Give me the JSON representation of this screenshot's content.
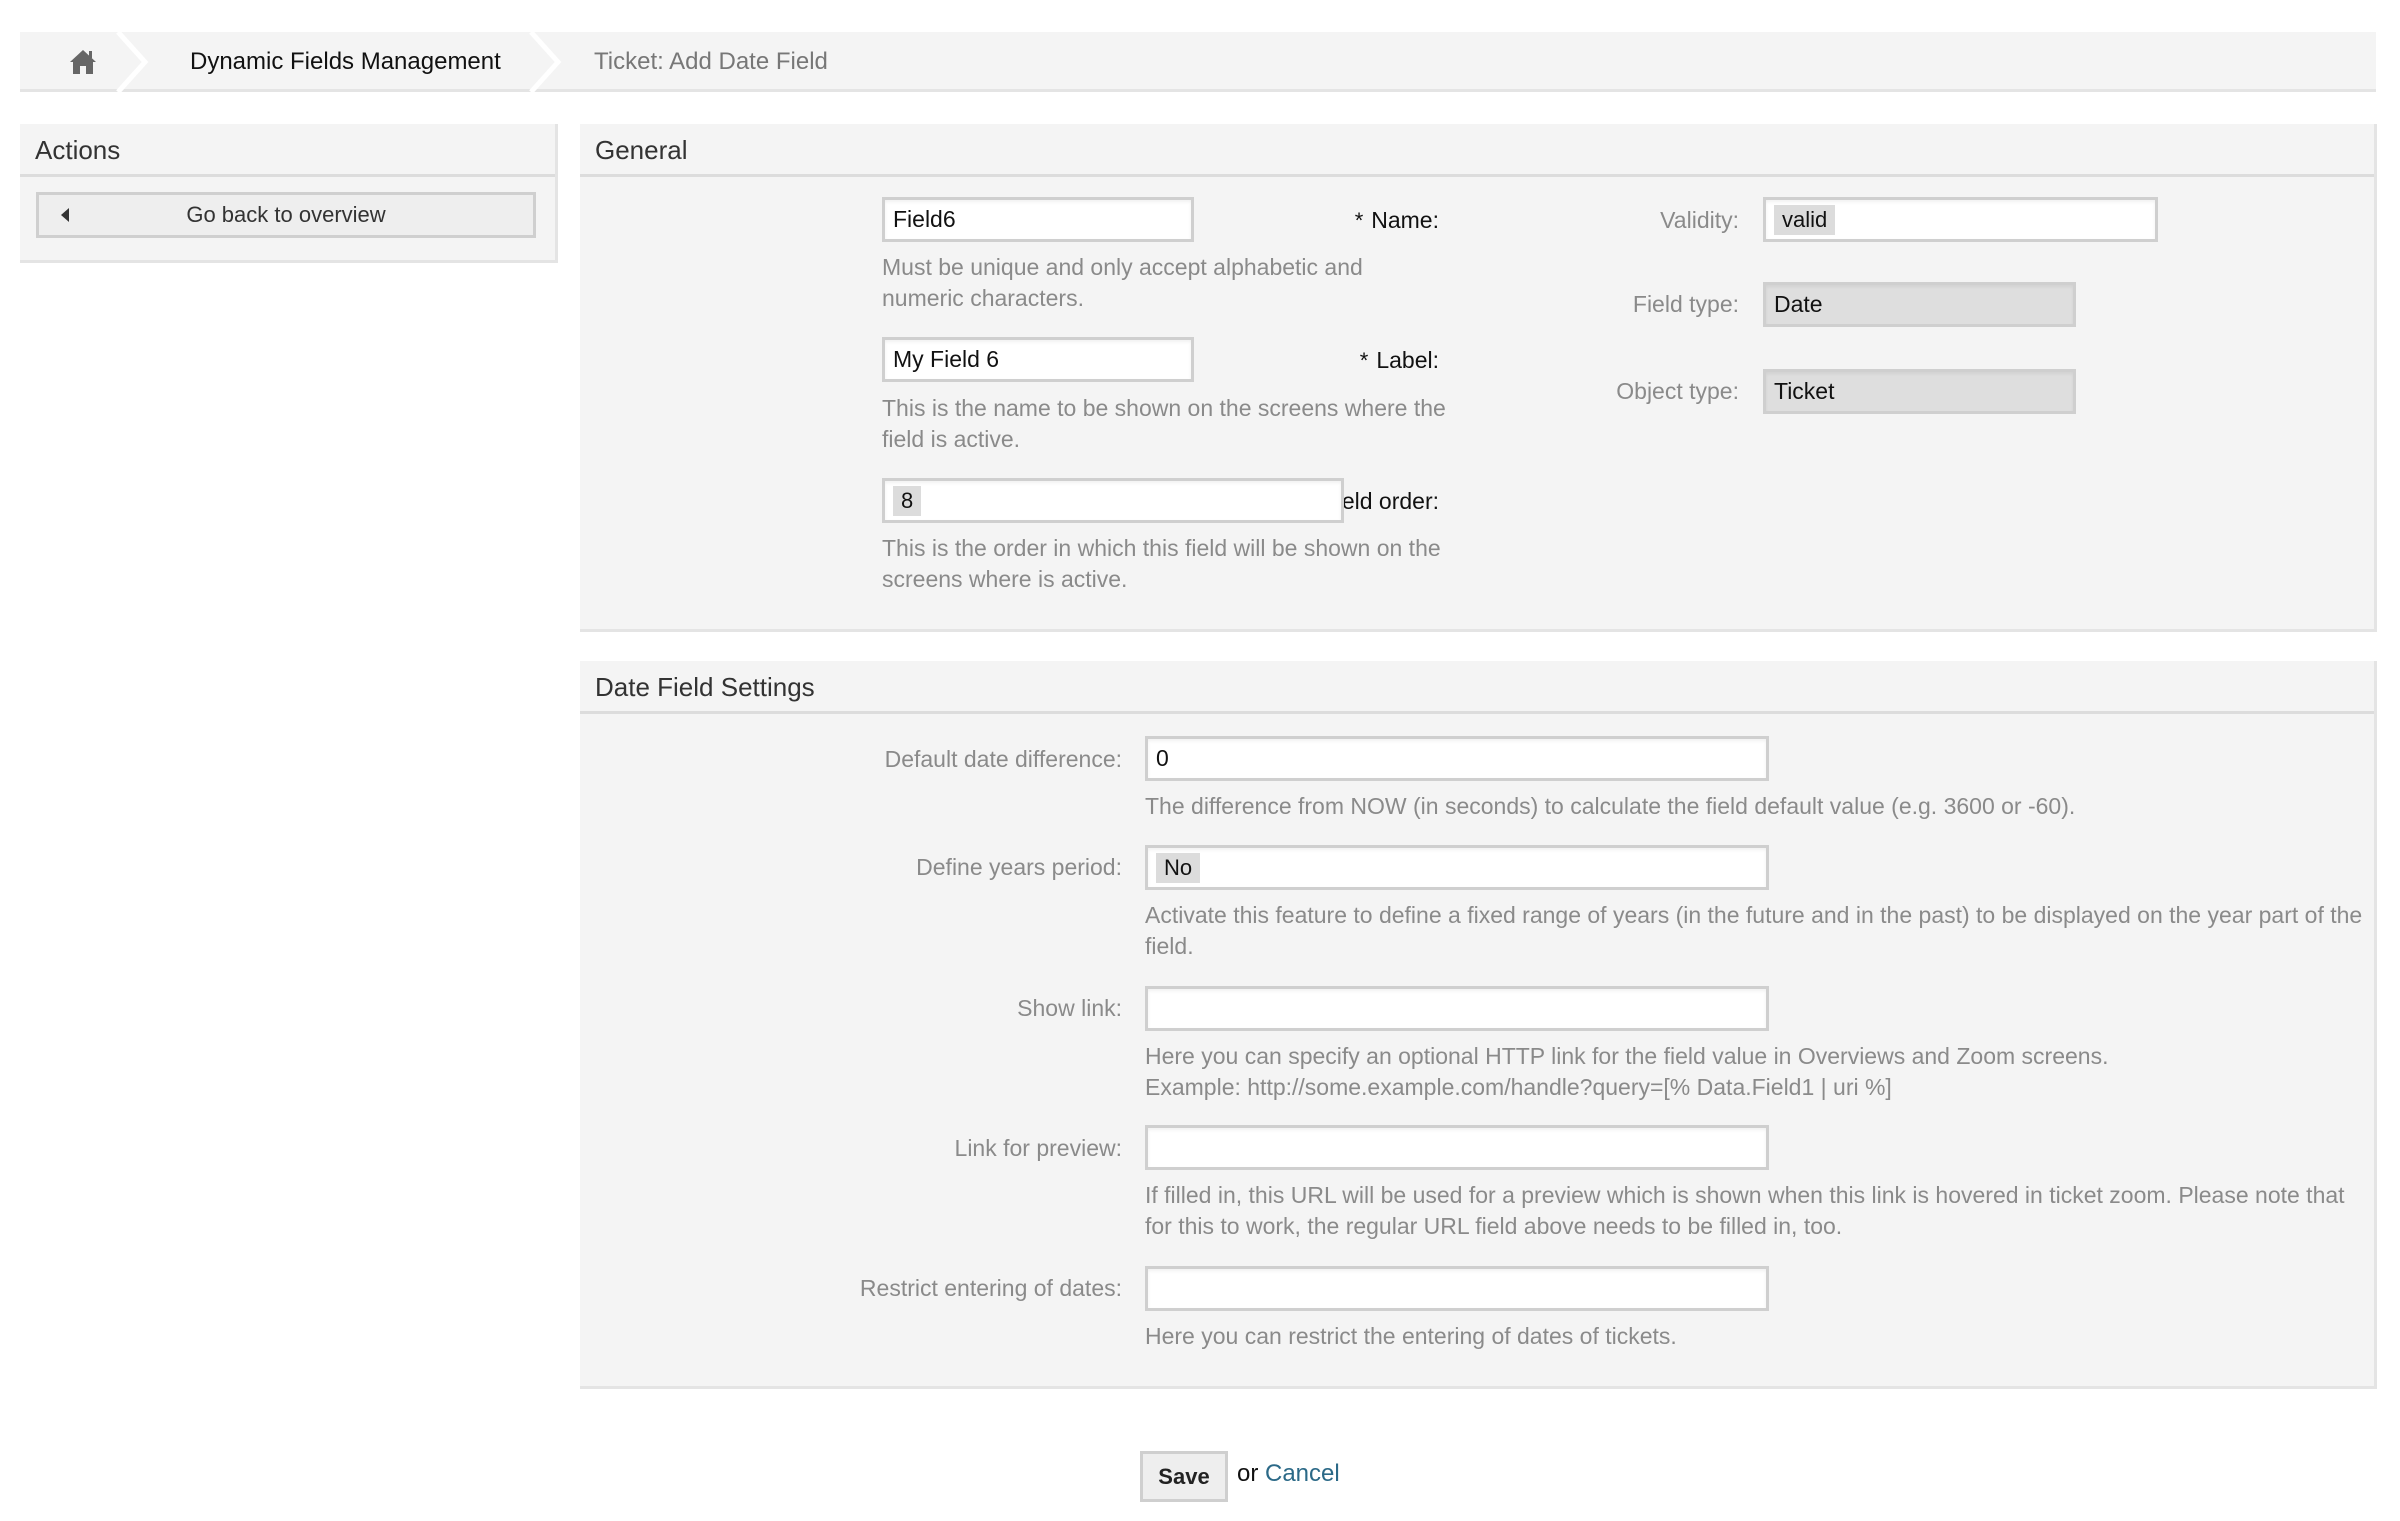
{
  "breadcrumb": {
    "home_icon": "home-icon",
    "items": [
      {
        "label": "Dynamic Fields Management"
      },
      {
        "label": "Ticket: Add Date Field"
      }
    ]
  },
  "sidebar": {
    "title": "Actions",
    "back_button": {
      "icon": "triangle-left-icon",
      "label": "Go back to overview"
    }
  },
  "general": {
    "title": "General",
    "name": {
      "label": "Name:",
      "required_mark": "*",
      "value": "Field6",
      "help": "Must be unique and only accept alphabetic and numeric characters."
    },
    "label": {
      "label": "Label:",
      "required_mark": "*",
      "value": "My Field 6",
      "help": "This is the name to be shown on the screens where the field is active."
    },
    "field_order": {
      "label": "Field order:",
      "required_mark": "*",
      "value": "8",
      "help": "This is the order in which this field will be shown on the screens where is active."
    },
    "validity": {
      "label": "Validity:",
      "value": "valid"
    },
    "field_type": {
      "label": "Field type:",
      "value": "Date"
    },
    "object_type": {
      "label": "Object type:",
      "value": "Ticket"
    }
  },
  "date_settings": {
    "title": "Date Field Settings",
    "default_date_difference": {
      "label": "Default date difference:",
      "value": "0",
      "help": "The difference from NOW (in seconds) to calculate the field default value (e.g. 3600 or -60)."
    },
    "define_years_period": {
      "label": "Define years period:",
      "value": "No",
      "help": "Activate this feature to define a fixed range of years (in the future and in the past) to be displayed on the year part of the field."
    },
    "show_link": {
      "label": "Show link:",
      "value": "",
      "help_line1": "Here you can specify an optional HTTP link for the field value in Overviews and Zoom screens.",
      "help_line2": "Example: http://some.example.com/handle?query=[% Data.Field1 | uri %]"
    },
    "link_preview": {
      "label": "Link for preview:",
      "value": "",
      "help": "If filled in, this URL will be used for a preview which is shown when this link is hovered in ticket zoom. Please note that for this to work, the regular URL field above needs to be filled in, too."
    },
    "restrict_dates": {
      "label": "Restrict entering of dates:",
      "value": "",
      "help": "Here you can restrict the entering of dates of tickets."
    }
  },
  "footer": {
    "save_label": "Save",
    "or_text": "or",
    "cancel_label": "Cancel"
  },
  "colors": {
    "panel_bg": "#f4f4f4",
    "link": "#2b6987",
    "muted_text": "#8a8a8a"
  }
}
